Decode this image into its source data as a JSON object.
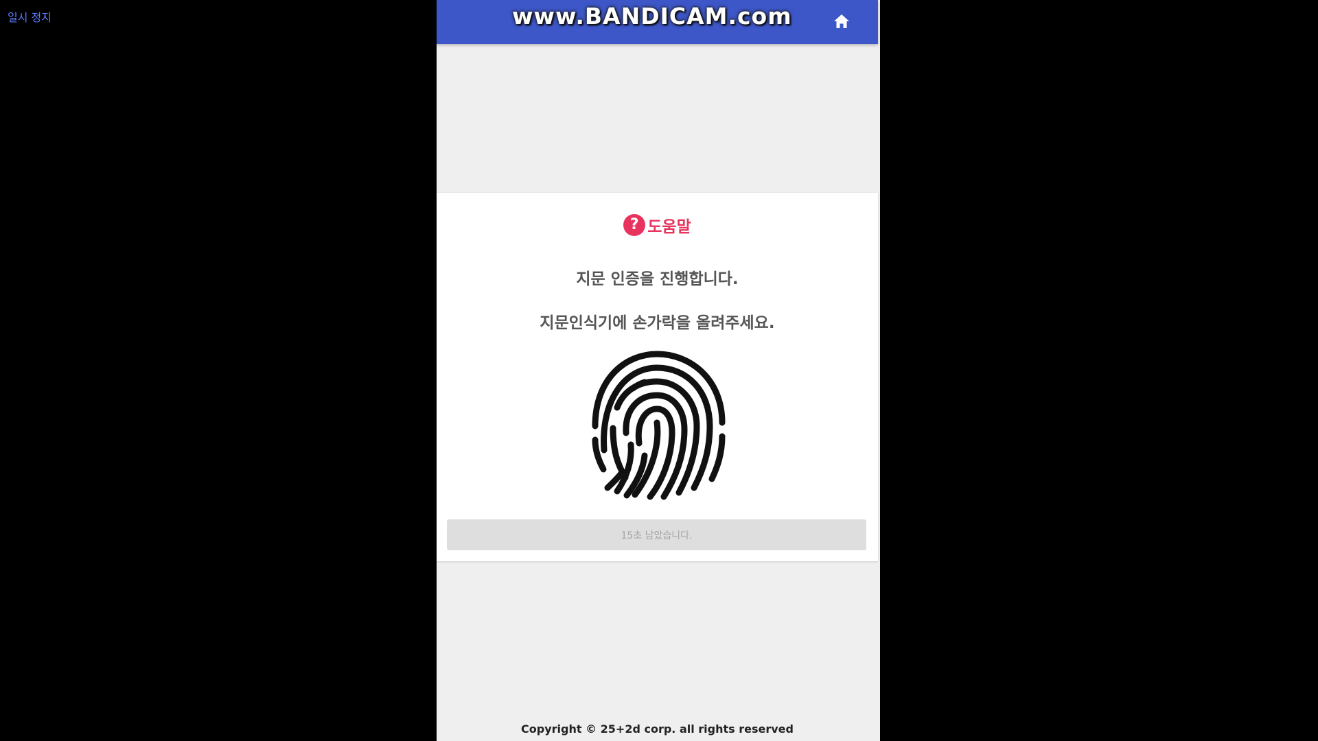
{
  "player": {
    "pause_label": "일시 정지"
  },
  "header": {
    "watermark": "www.BANDICAM.com",
    "home_icon": "home-icon",
    "color": "#3d57c8"
  },
  "help": {
    "icon": "question-circle-icon",
    "icon_glyph": "?",
    "title": "도움말",
    "accent_color": "#e8335e"
  },
  "message": {
    "line1": "지문 인증을 진행합니다.",
    "line2": "지문인식기에 손가락을 올려주세요."
  },
  "fingerprint": {
    "icon": "fingerprint-icon"
  },
  "countdown": {
    "text": "15초 남았습니다."
  },
  "footer": {
    "copyright": "Copyright © 25+2d corp. all rights reserved"
  }
}
